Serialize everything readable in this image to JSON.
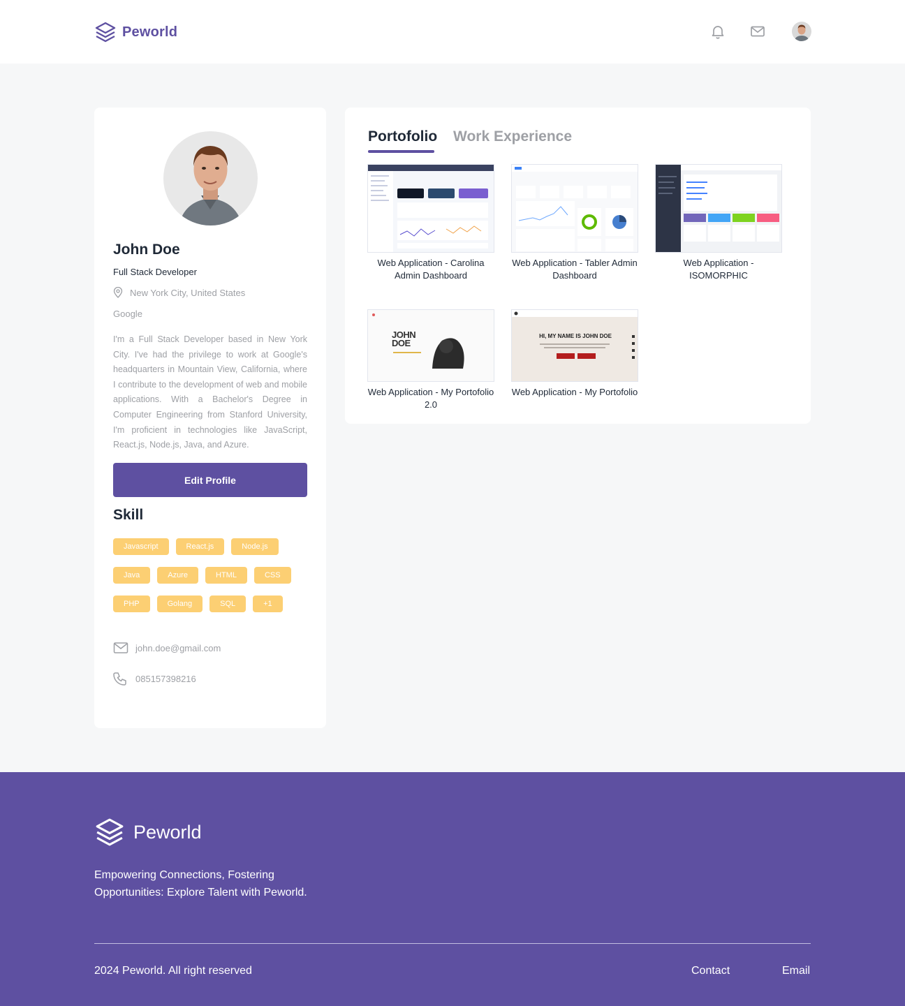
{
  "brand": {
    "name": "Peworld",
    "color": "#5e50a1"
  },
  "header": {
    "icons": [
      "bell-icon",
      "mail-icon",
      "user-avatar"
    ]
  },
  "profile": {
    "name": "John Doe",
    "title": "Full Stack Developer",
    "location": "New York City, United States",
    "company": "Google",
    "bio": "I'm a Full Stack Developer based in New York City. I've had the privilege to work at Google's headquarters in Mountain View, California, where I contribute to the development of web and mobile applications. With a Bachelor's Degree in Computer Engineering from Stanford University, I'm proficient in technologies like JavaScript, React.js, Node.js, Java, and Azure.",
    "edit_label": "Edit Profile",
    "skill_title": "Skill",
    "skills": [
      "Javascript",
      "React.js",
      "Node.js",
      "Java",
      "Azure",
      "HTML",
      "CSS",
      "PHP",
      "Golang",
      "SQL",
      "+1"
    ],
    "email": "john.doe@gmail.com",
    "phone": "085157398216"
  },
  "tabs": {
    "portfolio": "Portofolio",
    "experience": "Work Experience",
    "active": "portfolio"
  },
  "portfolio": [
    {
      "title": "Web Application - Carolina Admin Dashboard"
    },
    {
      "title": "Web Application - Tabler Admin Dashboard"
    },
    {
      "title": "Web Application - ISOMORPHIC"
    },
    {
      "title": "Web Application - My Portofolio 2.0",
      "thumb_text": "JOHN DOE"
    },
    {
      "title": "Web Application - My Portofolio",
      "thumb_text": "HI, MY NAME IS JOHN DOE"
    }
  ],
  "footer": {
    "brand": "Peworld",
    "tagline": "Empowering Connections, Fostering Opportunities: Explore Talent with Peworld.",
    "copyright": "2024 Peworld. All right reserved",
    "links": [
      "Contact",
      "Email"
    ]
  },
  "colors": {
    "accent": "#5e50a1",
    "skill": "#fbb017",
    "muted": "#9ea0a5"
  }
}
